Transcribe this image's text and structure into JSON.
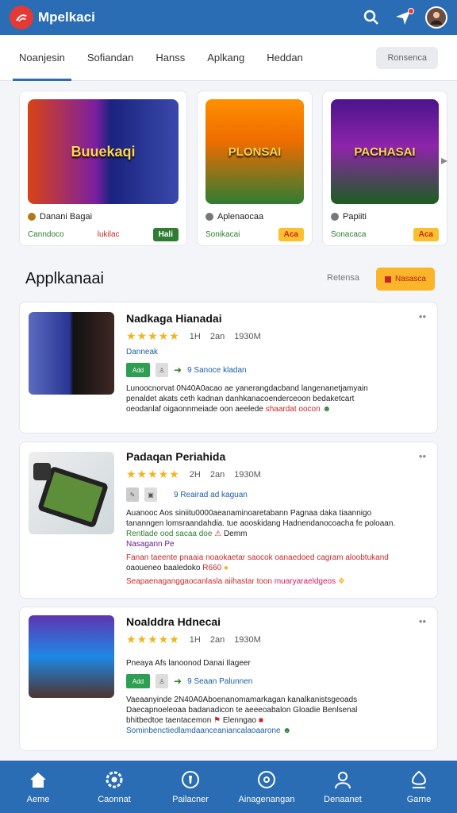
{
  "app": {
    "title": "Mpelkaci",
    "logo_icon": "app-logo-icon"
  },
  "tabs": [
    "Noanjesin",
    "Sofiandan",
    "Hanss",
    "Aplkang",
    "Heddan"
  ],
  "tab_button": "Ronsenca",
  "featured": [
    {
      "art": "Buuekaqi",
      "name": "Danani Bagai",
      "left": "Canndoco",
      "right": "lukilac",
      "badge": "Hali"
    },
    {
      "art": "PLONSAI",
      "name": "Aplenaocaa",
      "left": "Sonikacai",
      "badge": "Aca"
    },
    {
      "art": "PACHASAI",
      "name": "Papiiti",
      "left": "Sonacaca",
      "badge": "Aca"
    }
  ],
  "section": {
    "title": "Applkanaai",
    "link": "Retensa",
    "button": "Nasasca"
  },
  "apps": [
    {
      "title": "Nadkaga Hianadai",
      "rating_text": "1H",
      "meta2": "2an",
      "meta3": "1930M",
      "link": "Danneak",
      "chip1": "Add",
      "extra": "9 Sanoce kladan",
      "desc": [
        "Lunoocnorvat 0N40A0acao ae yanerangdacband langenanetjamyain",
        "penaldet akats ceth kadnan danhkanacoenderceoon bedaketcart",
        "oeodanlaf oigaonnmeiade oon aeelede"
      ],
      "desc_highlight": "shaardat oocon"
    },
    {
      "title": "Padaqan Periahida",
      "rating_text": "2H",
      "meta2": "2an",
      "meta3": "1930M",
      "extra": "9 Reairad ad kaguan",
      "desc": [
        "Auanooc Aos siniitu0000aeanaminoaretabann Pagnaa daka tiaannigo",
        "tananngen lomsraandahdia. tue aooskidang Hadnendanocoacha fe poloaan."
      ],
      "line_green": "Rentlade ood sacaa doe",
      "line_green_extra": "Demm",
      "line_purple": "Nasagann Pe",
      "line_red": "Fanan taeente pnaaia noaokaetar saocok oanaedoed cagram aloobtukand",
      "line_red2": "oaoueneo baaledoko",
      "line_red2_badge": "R660",
      "line_last": "Seapaenaganggaocanlasla aiihastar toon",
      "line_last_highlight": "muaryaraeldgeos"
    },
    {
      "title": "Noalddra Hdnecai",
      "rating_text": "1H",
      "meta2": "2an",
      "meta3": "1930M",
      "link": "Pneaya Afs lanoonod Danai Ilageer",
      "chip1": "Add",
      "extra": "9 Seaan Palunnen",
      "desc": [
        "Vaeaanyinde 2N40A0Aboenanomamarkagan kanalkanistsgeoads",
        "Daecapnoeleoaa badanadicon te aeeeoabalon Gloadie Benlsenal",
        "bhitbedtoe taentacemon",
        "Sominbenctiedlamdaanceaniancalaoaarone"
      ],
      "desc_extra": "Elenngao"
    }
  ],
  "bottom_nav": [
    "Aeme",
    "Caonnat",
    "Pailacner",
    "Ainagenangan",
    "Denaanet",
    "Garne"
  ],
  "colors": {
    "primary": "#2a6db4",
    "accent": "#fbb52b",
    "star": "#f2b41c",
    "green": "#2e7d32",
    "red": "#c62828"
  }
}
